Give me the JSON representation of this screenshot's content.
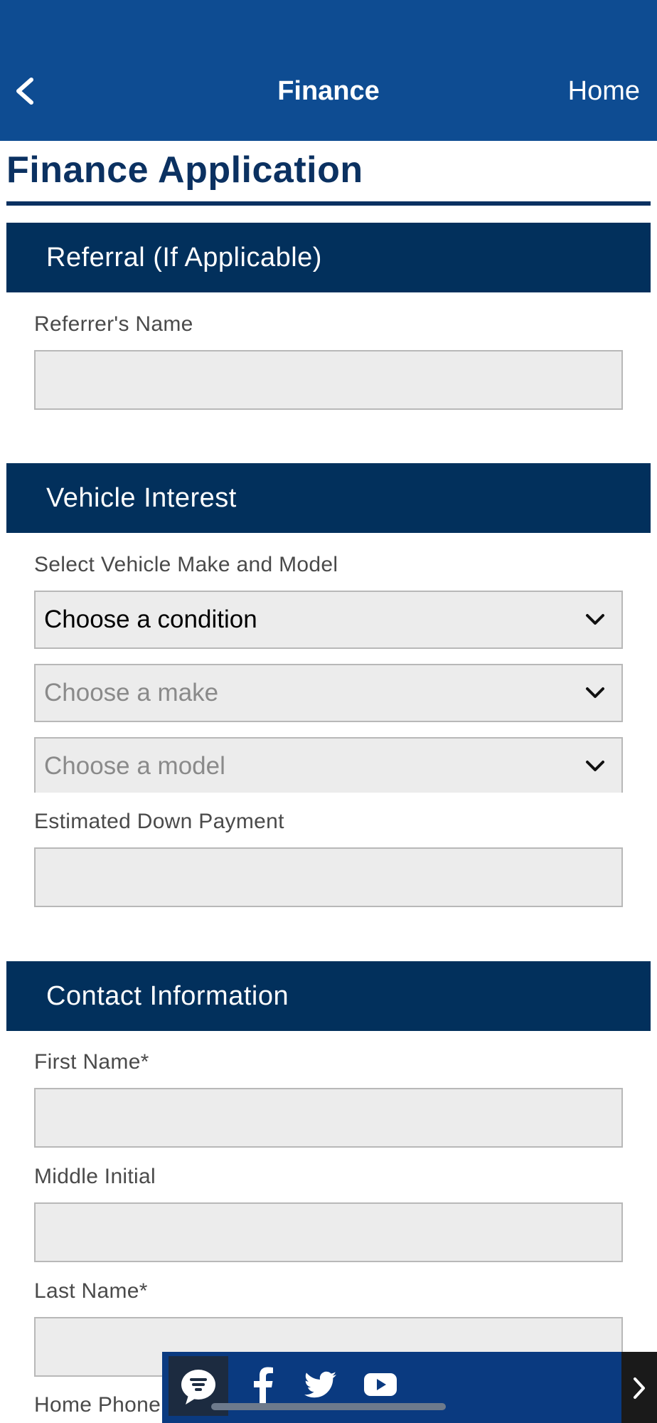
{
  "header": {
    "title": "Finance",
    "home_label": "Home",
    "background": "#0e4c92"
  },
  "page": {
    "title": "Finance Application",
    "accent": "#0b3161"
  },
  "sections": {
    "referral": {
      "title": "Referral (If Applicable)",
      "referrer_label": "Referrer's Name",
      "referrer_value": ""
    },
    "vehicle": {
      "title": "Vehicle Interest",
      "select_label": "Select Vehicle Make and Model",
      "condition_value": "Choose a condition",
      "make_placeholder": "Choose a make",
      "model_placeholder": "Choose a model",
      "down_payment_label": "Estimated Down Payment",
      "down_payment_value": ""
    },
    "contact": {
      "title": "Contact Information",
      "first_name_label": "First Name*",
      "middle_initial_label": "Middle Initial",
      "last_name_label": "Last Name*",
      "home_phone_label": "Home Phone"
    }
  },
  "social_bar": {
    "icons": [
      "chat-icon",
      "facebook-icon",
      "twitter-icon",
      "youtube-icon"
    ],
    "next_icon": "chevron-right-icon",
    "background": "#0a3a80"
  }
}
